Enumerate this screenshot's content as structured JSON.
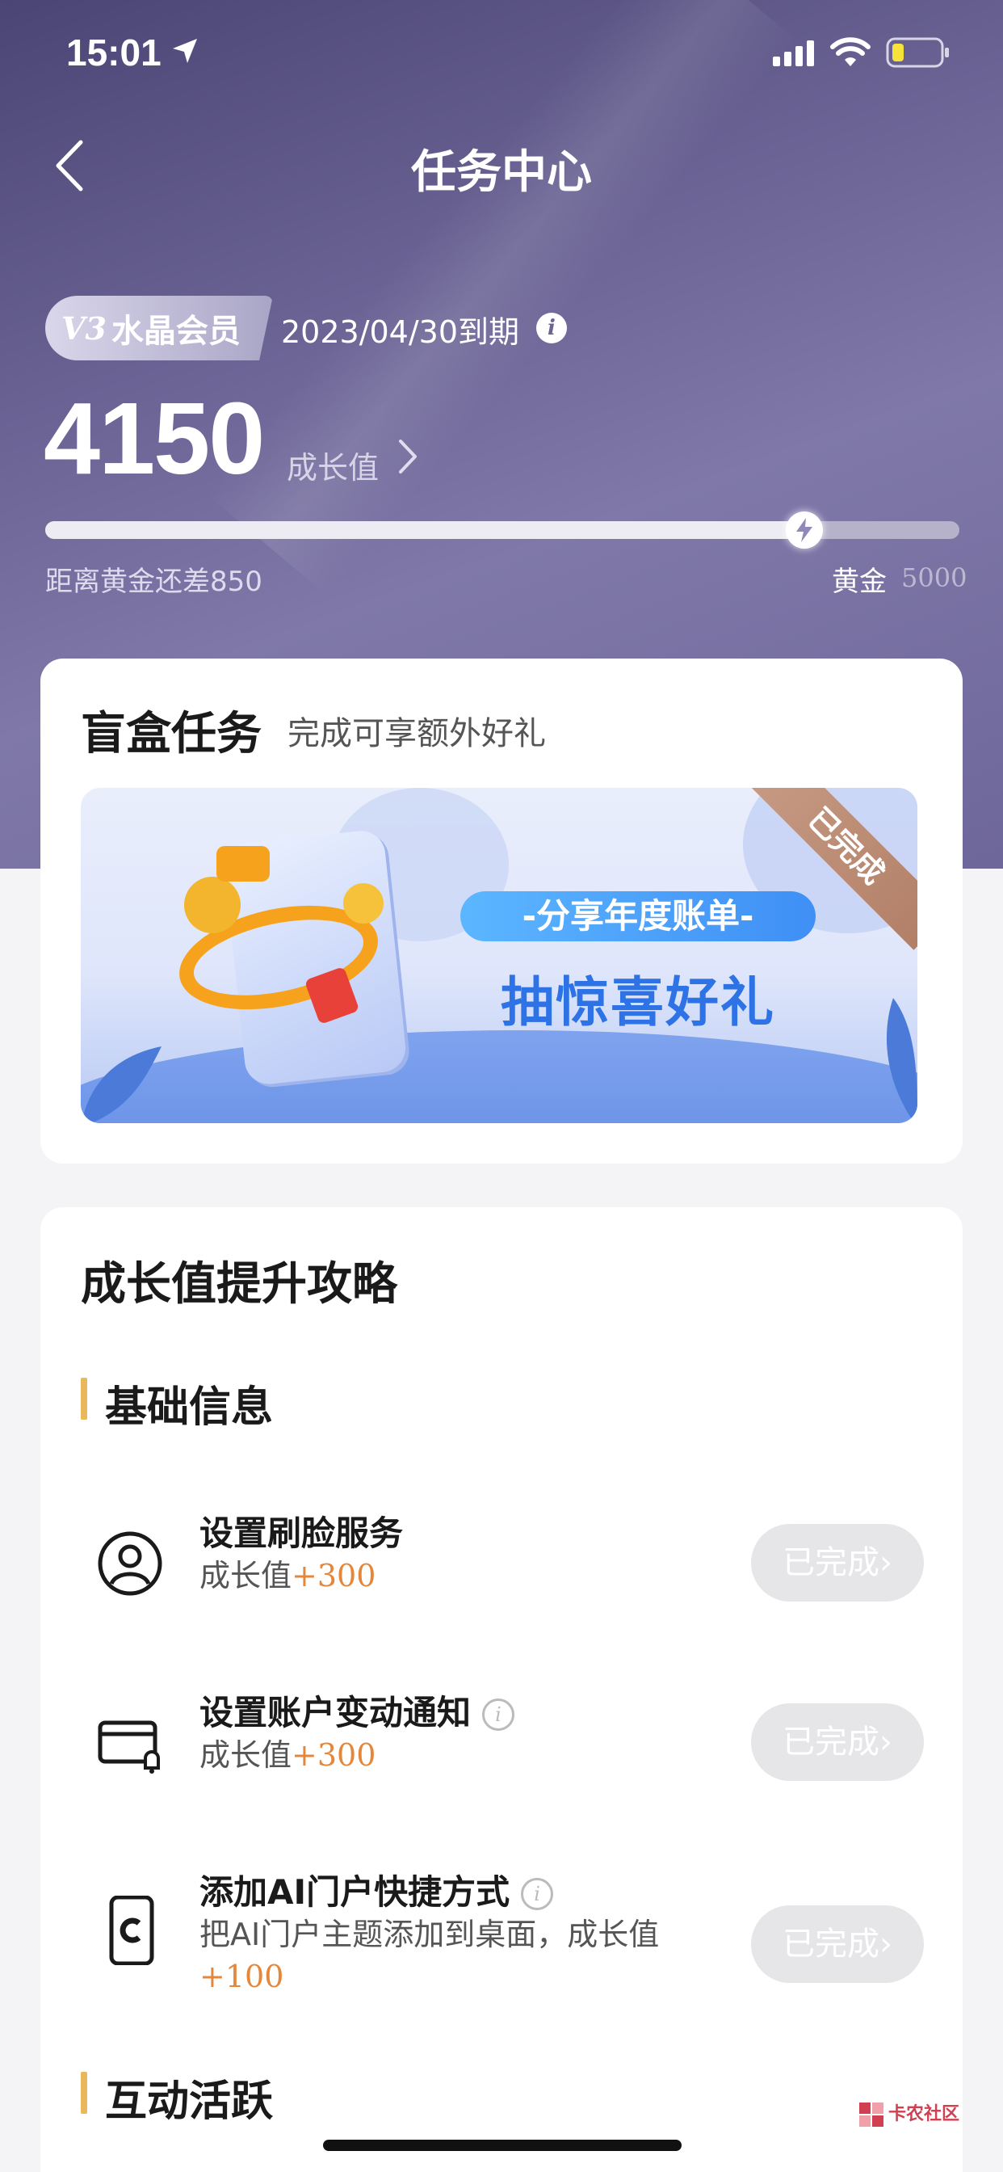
{
  "status_bar": {
    "time": "15:01"
  },
  "nav": {
    "title": "任务中心"
  },
  "membership": {
    "badge_logo": "V3",
    "badge_label": "水晶会员",
    "expiry": "2023/04/30到期",
    "info_glyph": "i"
  },
  "growth": {
    "score": "4150",
    "score_label": "成长值",
    "progress_fraction": 0.83,
    "distance_text": "距离黄金还差850",
    "next_level_label": "黄金",
    "next_level_value": "5000"
  },
  "blind_box": {
    "title": "盲盒任务",
    "subtitle": "完成可享额外好礼",
    "banner_pill": "-分享年度账单-",
    "banner_headline": "抽惊喜好礼",
    "ribbon": "已完成"
  },
  "strategy": {
    "title": "成长值提升攻略",
    "sections": [
      {
        "label": "基础信息",
        "tasks": [
          {
            "title": "设置刷脸服务",
            "desc_prefix": "成长值",
            "points": "+300",
            "button": "已完成›",
            "icon": "face-icon",
            "has_info": false
          },
          {
            "title": "设置账户变动通知",
            "desc_prefix": "成长值",
            "points": "+300",
            "button": "已完成›",
            "icon": "card-bell-icon",
            "has_info": true
          },
          {
            "title": "添加AI门户快捷方式",
            "desc_prefix": "把AI门户主题添加到桌面，成长值",
            "points": "+100",
            "button": "已完成›",
            "icon": "phone-shortcut-icon",
            "has_info": true
          }
        ]
      },
      {
        "label": "互动活跃"
      }
    ]
  },
  "watermark": {
    "text": "卡农社区"
  },
  "colors": {
    "hero_bg": "#6a6394",
    "accent_gold": "#e8b85a",
    "points": "#e5873a",
    "button_disabled": "#e6e6e9"
  }
}
